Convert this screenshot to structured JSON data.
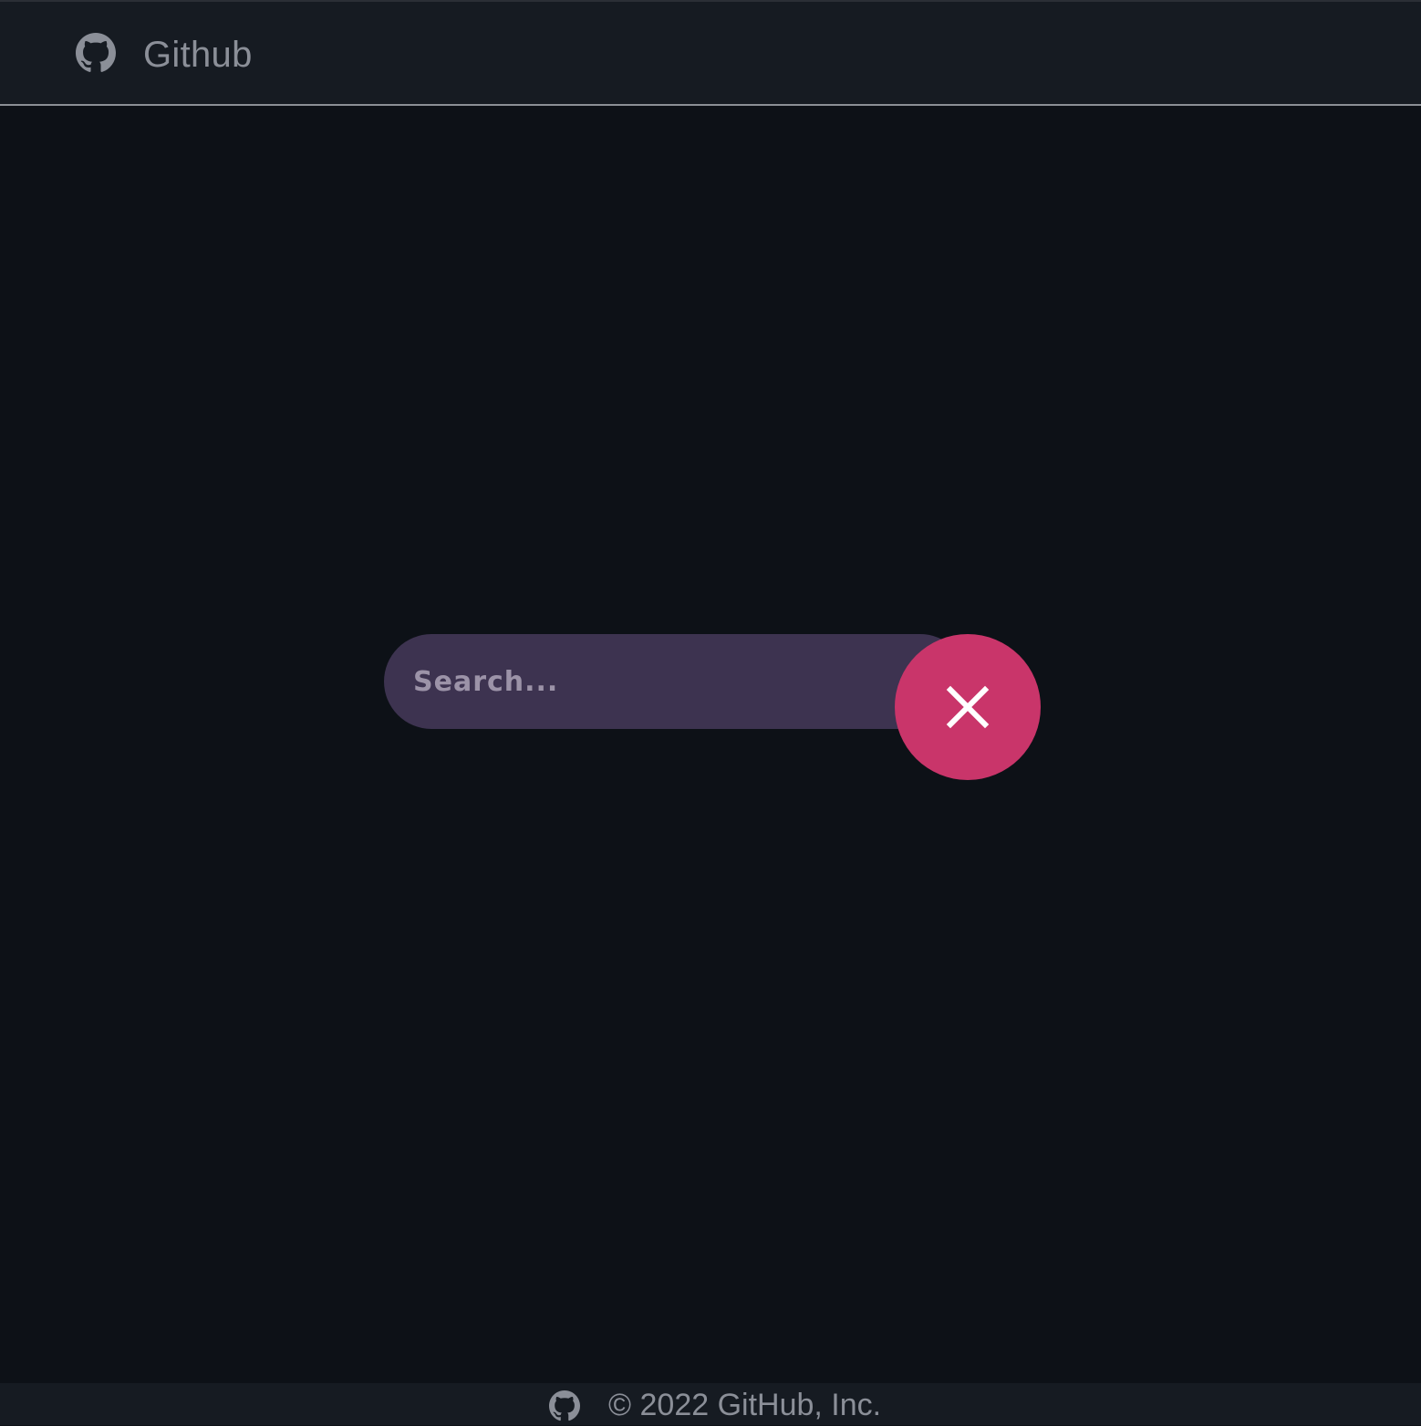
{
  "header": {
    "title": "Github",
    "logo_icon": "github-icon"
  },
  "search": {
    "placeholder": "Search...",
    "value": "",
    "close_icon": "close-icon"
  },
  "footer": {
    "copyright": "© 2022 GitHub, Inc.",
    "logo_icon": "github-icon"
  },
  "colors": {
    "background": "#0d1117",
    "header_bg": "#161b22",
    "search_bg": "#3d3350",
    "accent": "#c9356a",
    "muted_text": "#8b8f98"
  }
}
